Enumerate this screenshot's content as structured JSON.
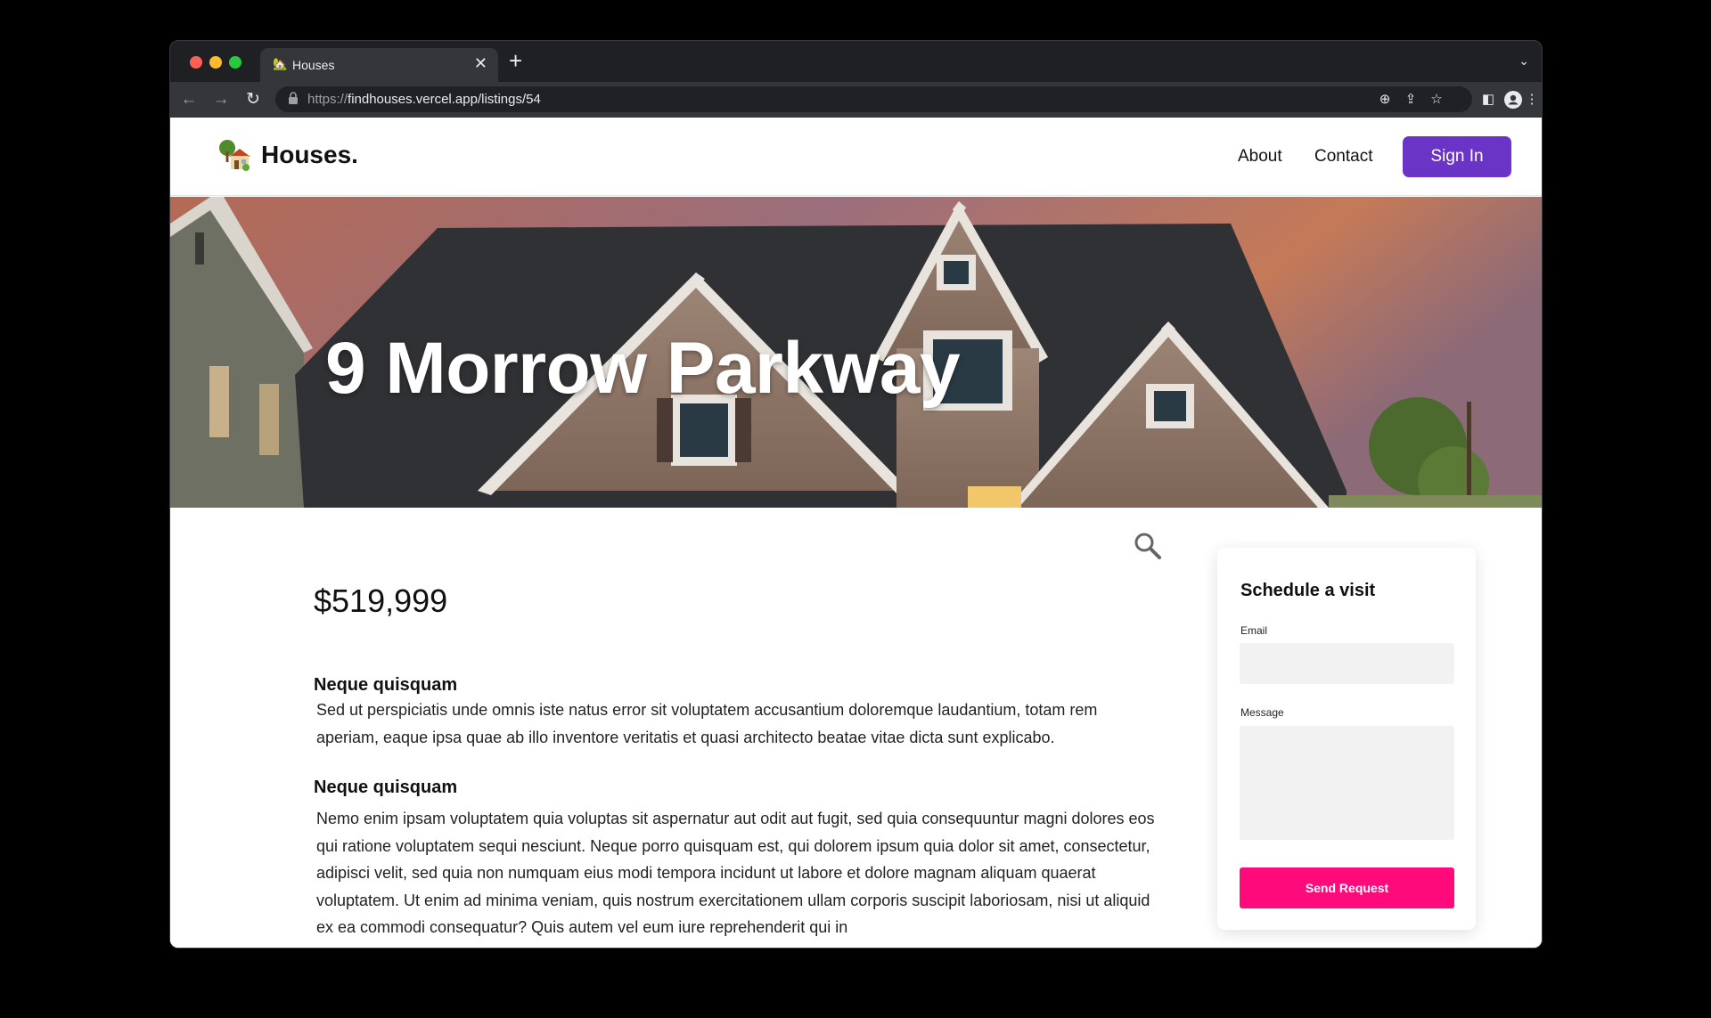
{
  "browser": {
    "tab_title": "Houses",
    "tab_favicon": "🏡",
    "url_scheme": "https://",
    "url_rest": "findhouses.vercel.app/listings/54",
    "icons": [
      "arrow-left-icon",
      "arrow-right-icon",
      "reload-icon",
      "lock-icon",
      "zoom-icon",
      "share-icon",
      "star-icon",
      "sidebar-icon",
      "profile-icon",
      "more-icon"
    ]
  },
  "site": {
    "logo_text": "Houses.",
    "nav": {
      "about": "About",
      "contact": "Contact"
    },
    "signin_label": "Sign In",
    "accent": "#6a35c6"
  },
  "listing": {
    "title": "9 Morrow Parkway",
    "price": "$519,999",
    "sections": [
      {
        "heading": "Neque quisquam",
        "body": "Sed ut perspiciatis unde omnis iste natus error sit voluptatem accusantium doloremque laudantium, totam rem aperiam, eaque ipsa quae ab illo inventore veritatis et quasi architecto beatae vitae dicta sunt explicabo."
      },
      {
        "heading": "Neque quisquam",
        "body": "Nemo enim ipsam voluptatem quia voluptas sit aspernatur aut odit aut fugit, sed quia consequuntur magni dolores eos qui ratione voluptatem sequi nesciunt. Neque porro quisquam est, qui dolorem ipsum quia dolor sit amet, consectetur, adipisci velit, sed quia non numquam eius modi tempora incidunt ut labore et dolore magnam aliquam quaerat voluptatem. Ut enim ad minima veniam, quis nostrum exercitationem ullam corporis suscipit laboriosam, nisi ut aliquid ex ea commodi consequatur? Quis autem vel eum iure reprehenderit qui in"
      }
    ]
  },
  "visit_form": {
    "title": "Schedule a visit",
    "email_label": "Email",
    "email_value": "",
    "message_label": "Message",
    "message_value": "",
    "submit_label": "Send Request",
    "submit_color": "#ff0a7a"
  }
}
